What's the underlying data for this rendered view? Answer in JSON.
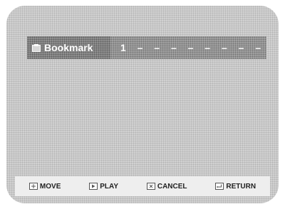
{
  "bookmark": {
    "label": "Bookmark",
    "icon": "bookmark-icon",
    "slots": [
      "1",
      "–",
      "–",
      "–",
      "–",
      "–",
      "–",
      "–",
      "–"
    ]
  },
  "footer": {
    "move": {
      "label": "MOVE",
      "icon": "move-key-icon"
    },
    "play": {
      "label": "PLAY",
      "icon": "play-key-icon"
    },
    "cancel": {
      "label": "CANCEL",
      "icon": "cancel-key-icon"
    },
    "return": {
      "label": "RETURN",
      "icon": "return-key-icon"
    }
  },
  "colors": {
    "screen": "#d2d2d2",
    "bar": "#a2a2a2",
    "label_bg": "#8f8f8f",
    "text_light": "#ffffff",
    "footer_bg": "#eeeeee"
  }
}
